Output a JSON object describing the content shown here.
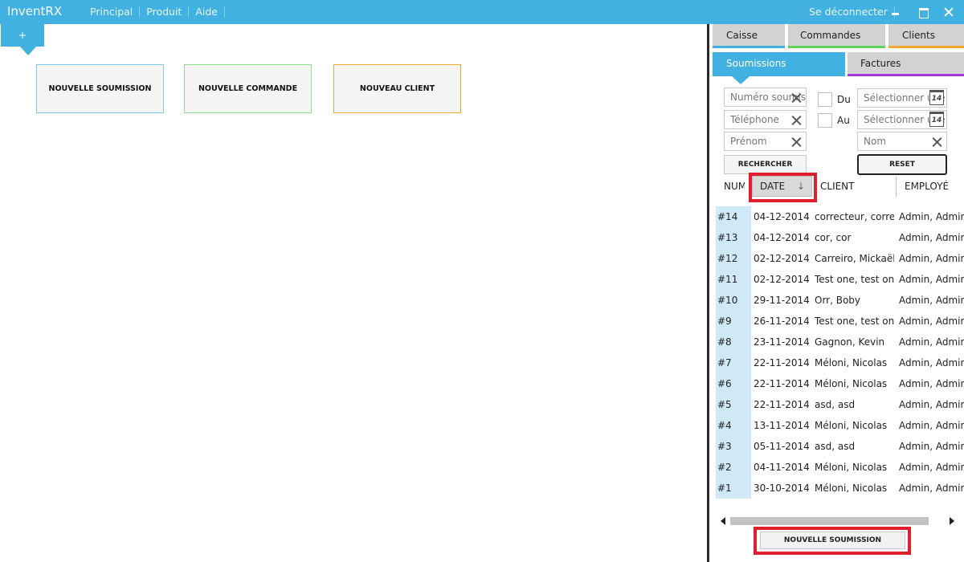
{
  "app": {
    "title": "InventRX",
    "menu": [
      "Principal",
      "Produit",
      "Aide"
    ],
    "logout": "Se déconnecter"
  },
  "colors": {
    "accent": "#41b1e1",
    "commandes": "#5fd45a",
    "clients": "#f3a530",
    "factures": "#a23ad6",
    "highlight": "#e01f2c"
  },
  "main": {
    "add_tab": "+",
    "tiles": {
      "soumission": "NOUVELLE SOUMISSION",
      "commande": "NOUVELLE COMMANDE",
      "client": "NOUVEAU CLIENT"
    }
  },
  "panel": {
    "tabs_top": [
      "Caisse",
      "Commandes",
      "Clients"
    ],
    "tabs_second": [
      "Soumissions",
      "Factures"
    ],
    "filters": {
      "numero_placeholder": "Numéro soumission",
      "telephone_placeholder": "Téléphone",
      "prenom_placeholder": "Prénom",
      "nom_placeholder": "Nom",
      "du_label": "Du",
      "au_label": "Au",
      "date_placeholder": "Sélectionner une date",
      "calendar_day": "14",
      "search_button": "RECHERCHER",
      "reset_button": "RESET"
    },
    "grid": {
      "headers": {
        "num": "NUMÉRO",
        "date": "DATE",
        "client": "CLIENT",
        "employe": "EMPLOYÉ"
      },
      "sort_indicator": "↓",
      "rows": [
        {
          "num": "#14",
          "date": "04-12-2014",
          "client": "correcteur, correcteur",
          "employe": "Admin, Admin"
        },
        {
          "num": "#13",
          "date": "04-12-2014",
          "client": "cor, cor",
          "employe": "Admin, Admin"
        },
        {
          "num": "#12",
          "date": "02-12-2014",
          "client": "Carreiro, Mickaël",
          "employe": "Admin, Admin"
        },
        {
          "num": "#11",
          "date": "02-12-2014",
          "client": "Test one, test one",
          "employe": "Admin, Admin"
        },
        {
          "num": "#10",
          "date": "29-11-2014",
          "client": "Orr, Boby",
          "employe": "Admin, Admin"
        },
        {
          "num": "#9",
          "date": "26-11-2014",
          "client": "Test one, test one",
          "employe": "Admin, Admin"
        },
        {
          "num": "#8",
          "date": "23-11-2014",
          "client": "Gagnon, Kevin",
          "employe": "Admin, Admin"
        },
        {
          "num": "#7",
          "date": "22-11-2014",
          "client": "Méloni, Nicolas",
          "employe": "Admin, Admin"
        },
        {
          "num": "#6",
          "date": "22-11-2014",
          "client": "Méloni, Nicolas",
          "employe": "Admin, Admin"
        },
        {
          "num": "#5",
          "date": "22-11-2014",
          "client": "asd, asd",
          "employe": "Admin, Admin"
        },
        {
          "num": "#4",
          "date": "13-11-2014",
          "client": "Méloni, Nicolas",
          "employe": "Admin, Admin"
        },
        {
          "num": "#3",
          "date": "05-11-2014",
          "client": "asd, asd",
          "employe": "Admin, Admin"
        },
        {
          "num": "#2",
          "date": "04-11-2014",
          "client": "Méloni, Nicolas",
          "employe": "Admin, Admin"
        },
        {
          "num": "#1",
          "date": "30-10-2014",
          "client": "Méloni, Nicolas",
          "employe": "Admin, Admin"
        }
      ]
    },
    "new_button": "NOUVELLE SOUMISSION"
  }
}
